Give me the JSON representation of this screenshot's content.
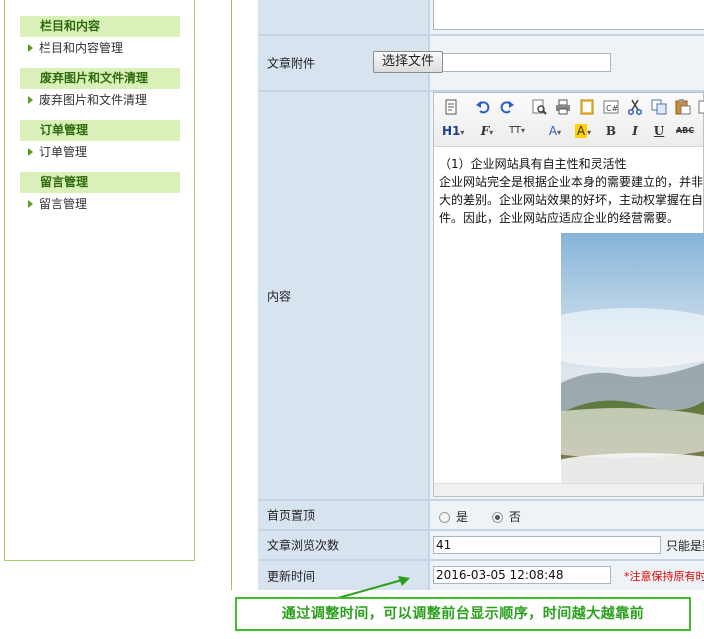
{
  "sidebar": {
    "sections": [
      {
        "title": "栏目和内容",
        "items": [
          "栏目和内容管理"
        ]
      },
      {
        "title": "废弃图片和文件清理",
        "items": [
          "废弃图片和文件清理"
        ]
      },
      {
        "title": "订单管理",
        "items": [
          "订单管理"
        ]
      },
      {
        "title": "留言管理",
        "items": [
          "留言管理"
        ]
      }
    ]
  },
  "form": {
    "attachment": {
      "label": "文章附件",
      "value": "",
      "button": "选择文件"
    },
    "content": {
      "label": "内容",
      "paragraphs": [
        "（1）企业网站具有自主性和灵活性",
        "企业网站完全是根据企业本身的需要建立的，并非",
        "大的差别。企业网站效果的好坏，主动权掌握在自",
        "件。因此，企业网站应适应企业的经营需要。"
      ]
    },
    "homepage_top": {
      "label": "首页置顶",
      "options": [
        "是",
        "否"
      ],
      "selected": "否"
    },
    "views": {
      "label": "文章浏览次数",
      "value": "41",
      "hint": "只能是数"
    },
    "update_time": {
      "label": "更新时间",
      "value": "2016-03-05 12:08:48",
      "note": "*注意保持原有时"
    }
  },
  "toolbar": {
    "row1_icons": [
      "source-icon",
      "undo-icon",
      "redo-icon",
      "preview-icon",
      "print-icon",
      "template-icon",
      "code-icon",
      "cut-icon",
      "copy-icon",
      "paste-icon"
    ],
    "row2": {
      "heading": "H1",
      "font": "F",
      "size": "TT",
      "forecolor": "A",
      "backcolor": "A",
      "bold": "B",
      "italic": "I",
      "underline": "U",
      "strike": "ABC"
    }
  },
  "callout": {
    "text": "通过调整时间，可以调整前台显示顺序，时间越大越靠前"
  },
  "colors": {
    "accent_green": "#3fbd2c",
    "sidebar_title_bg": "#daf0b9",
    "note_red": "#e10000"
  }
}
